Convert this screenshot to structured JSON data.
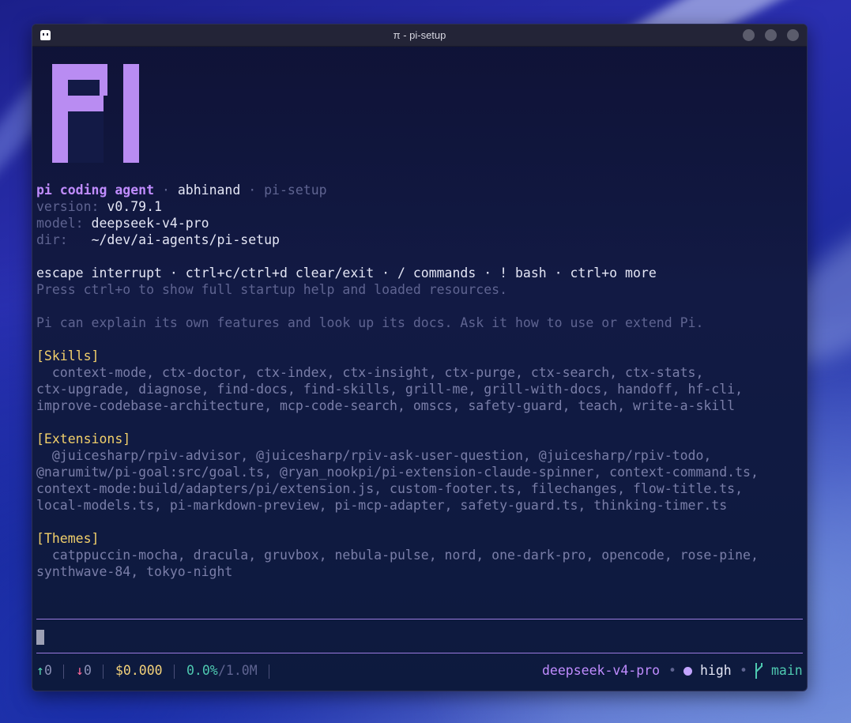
{
  "window": {
    "title": "π - pi-setup"
  },
  "header": {
    "app_name": "pi coding agent",
    "sep1": " · ",
    "user": "abhinand",
    "sep2": " · ",
    "project": "pi-setup",
    "version_label": "version:",
    "version_value": "v0.79.1",
    "model_label": "model:",
    "model_value": "deepseek-v4-pro",
    "dir_label": "dir:",
    "dir_value": "~/dev/ai-agents/pi-setup"
  },
  "help": {
    "shortcuts": "escape interrupt · ctrl+c/ctrl+d clear/exit · / commands · ! bash · ctrl+o more",
    "hint": "Press ctrl+o to show full startup help and loaded resources.",
    "explain": "Pi can explain its own features and look up its docs. Ask it how to use or extend Pi."
  },
  "skills": {
    "heading": "[Skills]",
    "lines": [
      "  context-mode, ctx-doctor, ctx-index, ctx-insight, ctx-purge, ctx-search, ctx-stats,",
      "ctx-upgrade, diagnose, find-docs, find-skills, grill-me, grill-with-docs, handoff, hf-cli,",
      "improve-codebase-architecture, mcp-code-search, omscs, safety-guard, teach, write-a-skill"
    ]
  },
  "extensions": {
    "heading": "[Extensions]",
    "lines": [
      "  @juicesharp/rpiv-advisor, @juicesharp/rpiv-ask-user-question, @juicesharp/rpiv-todo,",
      "@narumitw/pi-goal:src/goal.ts, @ryan_nookpi/pi-extension-claude-spinner, context-command.ts,",
      "context-mode:build/adapters/pi/extension.js, custom-footer.ts, filechanges, flow-title.ts,",
      "local-models.ts, pi-markdown-preview, pi-mcp-adapter, safety-guard.ts, thinking-timer.ts"
    ]
  },
  "themes": {
    "heading": "[Themes]",
    "lines": [
      "  catppuccin-mocha, dracula, gruvbox, nebula-pulse, nord, one-dark-pro, opencode, rose-pine,",
      "synthwave-84, tokyo-night"
    ]
  },
  "statusbar": {
    "up_arrow": "↑",
    "up_count": "0",
    "down_arrow": "↓",
    "down_count": "0",
    "cost": "$0.000",
    "context_pct": "0.0%",
    "context_max": "/1.0M",
    "model": "deepseek-v4-pro",
    "bullet1": "•",
    "thinking": "high",
    "bullet2": "•",
    "branch_icon": "branch-icon",
    "branch": "main"
  }
}
